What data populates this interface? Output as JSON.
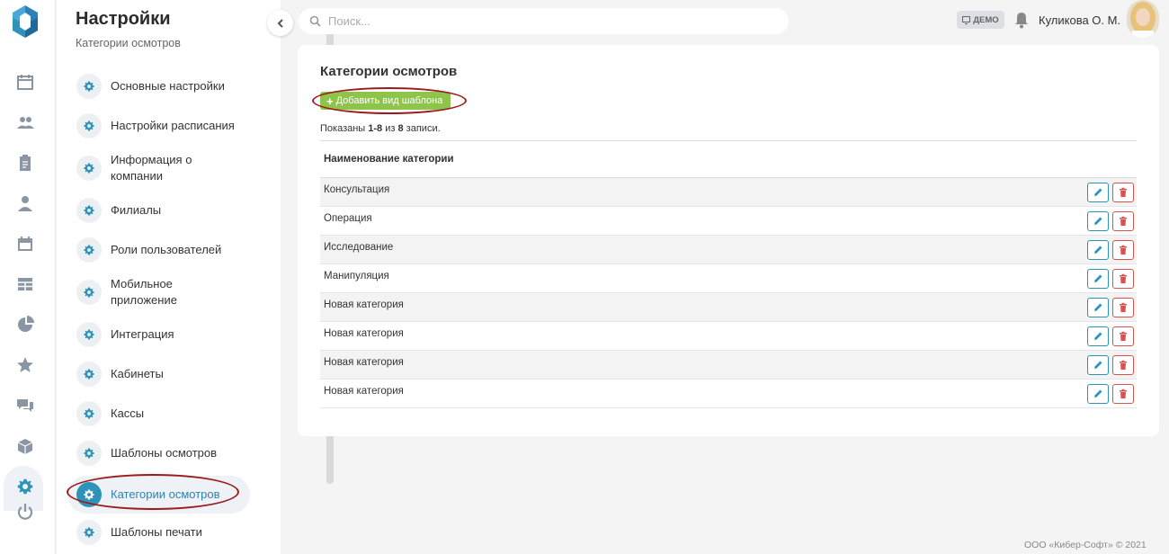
{
  "panel": {
    "title": "Настройки",
    "subtitle": "Категории осмотров",
    "menu": [
      {
        "label": "Основные настройки"
      },
      {
        "label": "Настройки расписания"
      },
      {
        "label": "Информация о компании"
      },
      {
        "label": "Филиалы"
      },
      {
        "label": "Роли пользователей"
      },
      {
        "label": "Мобильное приложение"
      },
      {
        "label": "Интеграция"
      },
      {
        "label": "Кабинеты"
      },
      {
        "label": "Кассы"
      },
      {
        "label": "Шаблоны осмотров"
      },
      {
        "label": "Категории осмотров",
        "active": true
      },
      {
        "label": "Шаблоны печати"
      }
    ]
  },
  "rail": {
    "icons": [
      "calendar-icon",
      "users-icon",
      "clipboard-icon",
      "doctor-icon",
      "schedule-icon",
      "table-icon",
      "pie-chart-icon",
      "star-icon",
      "chat-icon",
      "box-icon",
      "gear-icon",
      "power-icon"
    ],
    "active": "gear-icon"
  },
  "topbar": {
    "search_placeholder": "Поиск...",
    "demo_label": "ДЕМО",
    "user_name": "Куликова О. М."
  },
  "main": {
    "title": "Категории осмотров",
    "add_button": "Добавить вид шаблона",
    "summary": {
      "prefix": "Показаны ",
      "range": "1-8",
      "middle": " из ",
      "total": "8",
      "suffix": " записи."
    },
    "column_header": "Наименование категории",
    "rows": [
      "Консультация",
      "Операция",
      "Исследование",
      "Манипуляция",
      "Новая категория",
      "Новая категория",
      "Новая категория",
      "Новая категория"
    ]
  },
  "footer": "ООО «Кибер-Софт» © 2021",
  "colors": {
    "accent": "#2e93b8",
    "add_button": "#8dc449",
    "delete": "#d9534f",
    "annotation": "#9b1b1b"
  }
}
